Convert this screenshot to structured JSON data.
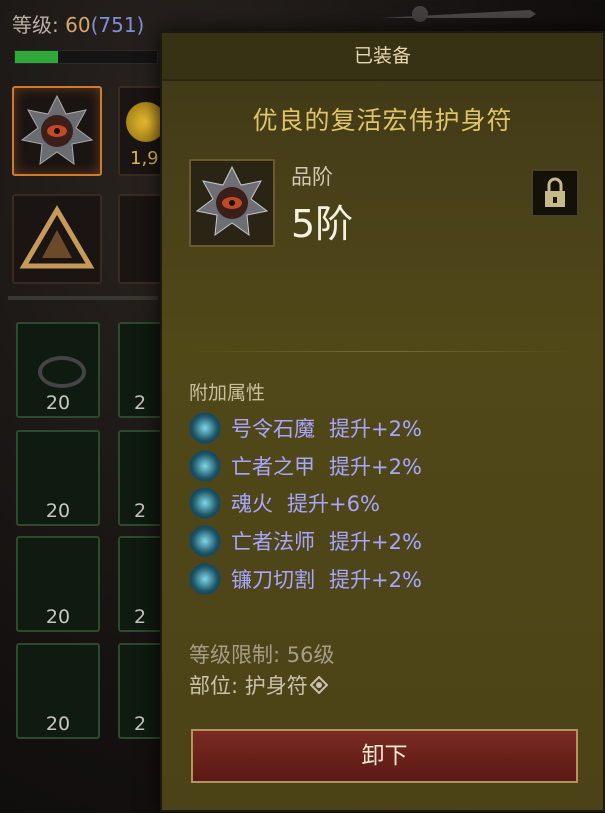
{
  "inventory": {
    "level_label": "等级:",
    "level_value": "60",
    "exp_value": "(751)",
    "exp_progress": 0.3,
    "slots": {
      "partial_count": "1,9",
      "gem_counts": [
        "20",
        "20",
        "20",
        "20"
      ],
      "gem_counts_right": [
        "2",
        "2",
        "2",
        "2"
      ]
    }
  },
  "tooltip": {
    "header": "已装备",
    "item_name": "优良的复活宏伟护身符",
    "grade_label": "品阶",
    "grade_value": "5阶",
    "attributes_title": "附加属性",
    "attributes": [
      {
        "name": "号令石魔",
        "bonus": "提升+2%"
      },
      {
        "name": "亡者之甲",
        "bonus": "提升+2%"
      },
      {
        "name": "魂火",
        "bonus": "提升+6%"
      },
      {
        "name": "亡者法师",
        "bonus": "提升+2%"
      },
      {
        "name": "镰刀切割",
        "bonus": "提升+2%"
      }
    ],
    "level_req": "等级限制: 56级",
    "slot_part": "部位: 护身符",
    "unequip_label": "卸下"
  },
  "colors": {
    "title": "#dfc46a",
    "attribute": "#a8a6ff",
    "button": "#7a2a22"
  },
  "icons": {
    "item": "amulet-eye-icon",
    "lock": "lock-icon",
    "slot_type": "amulet-type-icon"
  }
}
